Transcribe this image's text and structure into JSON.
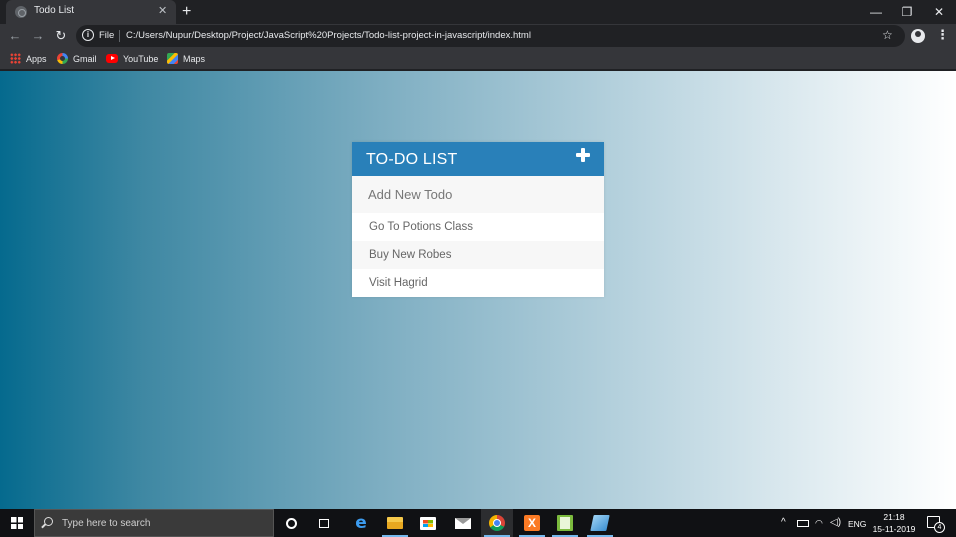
{
  "browser": {
    "tab_title": "Todo List",
    "tab_close": "✕",
    "new_tab": "+",
    "window_controls": {
      "minimize": "—",
      "restore": "❐",
      "close": "✕"
    },
    "nav": {
      "back": "←",
      "forward": "→",
      "reload": "↻"
    },
    "address": {
      "info": "i",
      "scheme_label": "File",
      "url": "C:/Users/Nupur/Desktop/Project/JavaScript%20Projects/Todo-list-project-in-javascript/index.html"
    },
    "star": "☆",
    "menu": "⋮",
    "bookmarks": [
      {
        "label": "Apps",
        "icon": "apps-grid-icon"
      },
      {
        "label": "Gmail",
        "icon": "google-icon"
      },
      {
        "label": "YouTube",
        "icon": "youtube-icon"
      },
      {
        "label": "Maps",
        "icon": "maps-icon"
      }
    ]
  },
  "todo_app": {
    "header": "TO-DO LIST",
    "add_icon": "plus-icon",
    "input_placeholder": "Add New Todo",
    "items": [
      "Go To Potions Class",
      "Buy New Robes",
      "Visit Hagrid"
    ],
    "colors": {
      "header": "#2980b9",
      "background_left": "#056a8e",
      "background_right": "#ffffff"
    }
  },
  "taskbar": {
    "search_placeholder": "Type here to search",
    "xampp_letter": "X",
    "tray": {
      "chevron": "^",
      "language": "ENG",
      "time": "21:18",
      "date": "15-11-2019",
      "notifications": "4"
    }
  }
}
